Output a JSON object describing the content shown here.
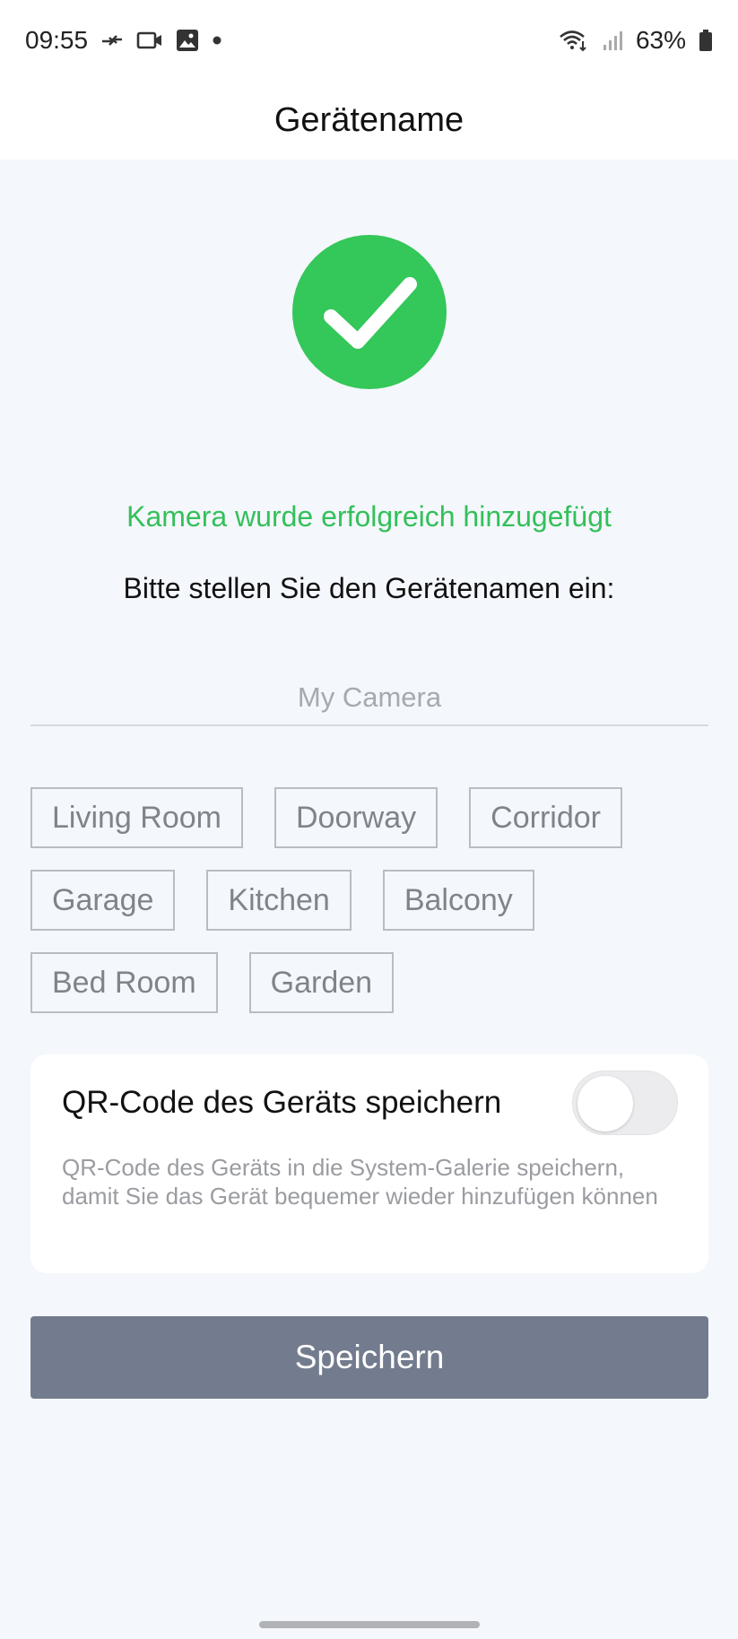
{
  "status_bar": {
    "time": "09:55",
    "battery": "63%",
    "icons_left": [
      "call-transfer-icon",
      "video-icon",
      "image-icon",
      "dot-icon"
    ],
    "icons_right": [
      "wifi-icon",
      "signal-icon",
      "battery-icon"
    ]
  },
  "header": {
    "title": "Gerätename"
  },
  "main": {
    "success_message": "Kamera wurde erfolgreich hinzugefügt",
    "prompt": "Bitte stellen Sie den Gerätenamen ein:",
    "name_input": {
      "value": "",
      "placeholder": "My Camera"
    },
    "suggestions": [
      [
        "Living Room",
        "Doorway",
        "Corridor"
      ],
      [
        "Garage",
        "Kitchen",
        "Balcony"
      ],
      [
        "Bed Room",
        "Garden"
      ]
    ],
    "qr_card": {
      "title": "QR-Code des Geräts speichern",
      "description": "QR-Code des Geräts in die System-Galerie speichern, damit Sie das Gerät bequemer wieder hinzufügen können",
      "toggle_on": false
    },
    "save_label": "Speichern"
  },
  "colors": {
    "accent_green": "#34c759",
    "success_text": "#34c05a",
    "button_bg": "#737c8e",
    "page_bg": "#f4f7fc"
  }
}
